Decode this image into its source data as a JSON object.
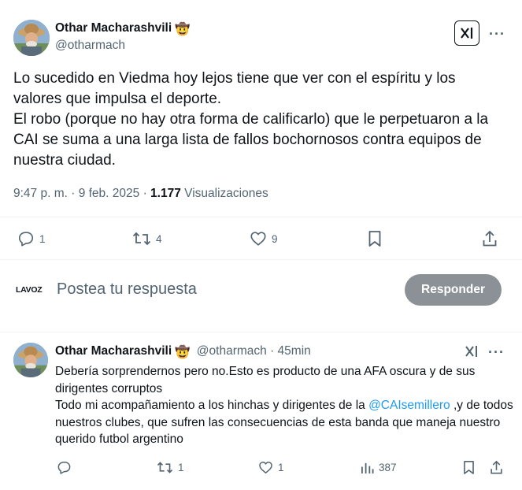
{
  "main_post": {
    "author_name": "Othar Macharashvili",
    "author_emoji": "🤠",
    "author_handle": "@otharmach",
    "paragraphs": [
      "Lo sucedido en Viedma hoy lejos tiene que ver con el espíritu y los valores que impulsa el deporte.",
      "El robo (porque no hay otra forma de calificarlo) que le perpetuaron a la CAI se suma a una larga lista de fallos bochornosos contra equipos de nuestra ciudad."
    ],
    "timestamp": "9:47 p. m. · 9 feb. 2025 · ",
    "views_count": "1.177",
    "views_label": " Visualizaciones",
    "actions": {
      "reply_count": "1",
      "retweet_count": "4",
      "like_count": "9"
    }
  },
  "reply_composer": {
    "logo_text": "LAVOZ",
    "placeholder": "Postea tu respuesta",
    "button_label": "Responder"
  },
  "reply_post": {
    "author_name": "Othar Macharashvili",
    "author_emoji": "🤠",
    "author_handle": "@otharmach",
    "separator": " · ",
    "time_ago": "45min",
    "line1": "Debería sorprendernos pero no.Esto es producto de una AFA oscura y de sus dirigentes corruptos",
    "line2_before": "Todo mi acompañamiento a los hinchas y dirigentes de la ",
    "mention": "@CAIsemillero",
    "line2_after": " ,y de todos nuestros clubes, que sufren las consecuencias de esta banda que maneja nuestro querido futbol argentino",
    "actions": {
      "reply_count": "",
      "retweet_count": "1",
      "like_count": "1",
      "views_count": "387"
    }
  },
  "colors": {
    "text": "#0f1419",
    "secondary": "#536471",
    "link": "#1d9bf0",
    "divider": "#eff3f4",
    "disabled_button": "#8b9196"
  }
}
